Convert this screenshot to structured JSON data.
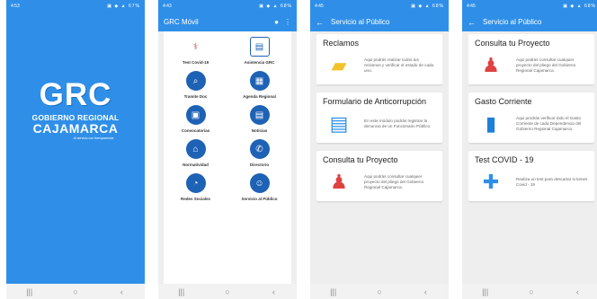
{
  "screens": {
    "splash": {
      "time": "4:53",
      "battery": "67%",
      "logo_text": "GRC",
      "line1": "GOBIERNO REGIONAL",
      "line2": "CAJAMARCA",
      "tagline": "Al servicio con transparencia"
    },
    "home": {
      "time": "4:43",
      "battery": "68%",
      "title": "GRC Móvil",
      "tiles": [
        {
          "label": "Test Covid-19",
          "icon": "doctor-icon"
        },
        {
          "label": "Asistencia GRC",
          "icon": "id-card-icon"
        },
        {
          "label": "Tramite Doc",
          "icon": "document-search-icon"
        },
        {
          "label": "Agenda Regional",
          "icon": "calendar-icon"
        },
        {
          "label": "Convocatorias",
          "icon": "announcement-icon"
        },
        {
          "label": "Noticias",
          "icon": "newspaper-icon"
        },
        {
          "label": "Normatividad",
          "icon": "building-icon"
        },
        {
          "label": "Directorio",
          "icon": "phone-icon"
        },
        {
          "label": "Redes Sociales",
          "icon": "rss-icon"
        },
        {
          "label": "Servicio al Público",
          "icon": "people-icon"
        }
      ]
    },
    "servicio1": {
      "time": "4:45",
      "battery": "68%",
      "title": "Servicio al Público",
      "cards": [
        {
          "title": "Reclamos",
          "desc": "Aqui podrás realizar todos tus reclamos y verificar el estado de cada uno."
        },
        {
          "title": "Formulario de Anticorrupción",
          "desc": "En este módulo podrás registrar la denuncia de un Funcionario Público."
        },
        {
          "title": "Consulta tu Proyecto",
          "desc": "Aqui podrás consultar cualquier proyecto del pliego del Gobierno Regional Cajamarca."
        }
      ]
    },
    "servicio2": {
      "time": "4:45",
      "battery": "68%",
      "title": "Servicio al Público",
      "cards": [
        {
          "title": "Consulta tu Proyecto",
          "desc": "Aqui podrás consultar cualquier proyecto del pliego del Gobierno Regional Cajamarca."
        },
        {
          "title": "Gasto Corriente",
          "desc": "Aqui prodrás verificar todo el Gasto Corriente de cada Dependencia del Gobierno Regional Cajamarca."
        },
        {
          "title": "Test COVID - 19",
          "desc": "Realiza un test para descartar si tienes Covid - 19"
        }
      ]
    }
  },
  "colors": {
    "primary": "#2f8fe8",
    "icon_blue": "#1e62b5",
    "accent_red": "#d83a3a"
  }
}
